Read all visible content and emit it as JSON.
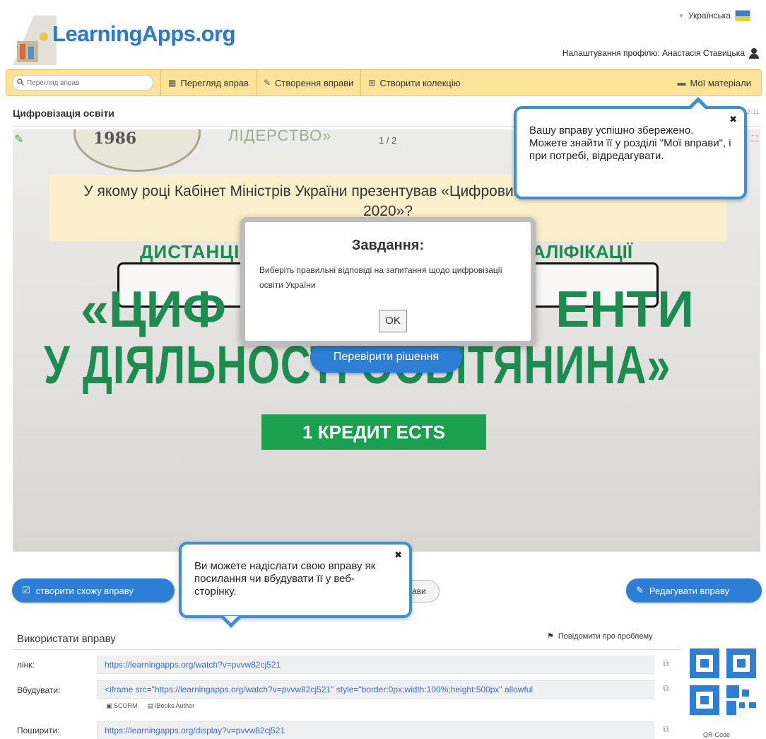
{
  "header": {
    "logo_text": "LearningApps.org",
    "language": "Українська",
    "profile_label": "Налаштування профілю: Анастасія Ставицька"
  },
  "nav": {
    "search_placeholder": "Перегляд вправ",
    "items": [
      {
        "label": "Перегляд вправ",
        "icon": "grid-icon"
      },
      {
        "label": "Створення вправи",
        "icon": "pencil-icon"
      },
      {
        "label": "Створити колекцію",
        "icon": "collection-icon"
      }
    ],
    "my_materials": "Мої матеріали"
  },
  "page": {
    "title": "Цифровізація освіти",
    "date_fragment": "2-11"
  },
  "app": {
    "page_counter": "1 / 2",
    "seal_year": "1986",
    "lidership_text": "ЛІДЕРСТВО»",
    "question": "У якому році Кабінет Міністрів України презентував «Цифровий порядок денний України 2020»?",
    "course_line1_left": "ДИСТАНЦІ",
    "course_line1_right": "АЛІФІКАЦІЇ",
    "big_quote_left": "«ЦИФ",
    "big_quote_right": "ЕНТИ",
    "big_line2": "У ДІЯЛЬНОСТІ ОСВІТЯНИНА»",
    "ects": "1 КРЕДИТ ECTS",
    "check_button": "Перевірити рішення"
  },
  "modal": {
    "title": "Завдання:",
    "body": "Виберіть правильні відповіді на запитання щодо цифровізації освіти України",
    "ok": "OK"
  },
  "tooltips": {
    "saved": "Вашу вправу успішно збережено. Можете знайти її у розділі \"Мої вправи\", і при потребі, відредагувати.",
    "share": "Ви можете надіслати свою вправу як посилання чи вбудувати її у веб-сторінку."
  },
  "actions": {
    "create_similar": "створити схожу вправу",
    "partial_button": "ави",
    "edit": "Редагувати вправу"
  },
  "use_section": {
    "title": "Використати вправу",
    "report": "Повідомити про проблему",
    "rows": [
      {
        "label": "лінк:",
        "value": "https://learningapps.org/watch?v=pvvw82cj521"
      },
      {
        "label": "Вбудувати:",
        "value": "<iframe src=\"https://learningapps.org/watch?v=pvvw82cj521\" style=\"border:0px;width:100%;height:500px\" allowful"
      },
      {
        "label": "Поширити:",
        "value": "https://learningapps.org/display?v=pvvw82cj521"
      }
    ],
    "scorm": "SCORM",
    "ibooks": "iBooks Author",
    "qr_label": "QR-Code"
  },
  "colors": {
    "accent_blue": "#2d7fd6",
    "nav_yellow": "#fbe49a",
    "course_green": "#1d8c52"
  }
}
